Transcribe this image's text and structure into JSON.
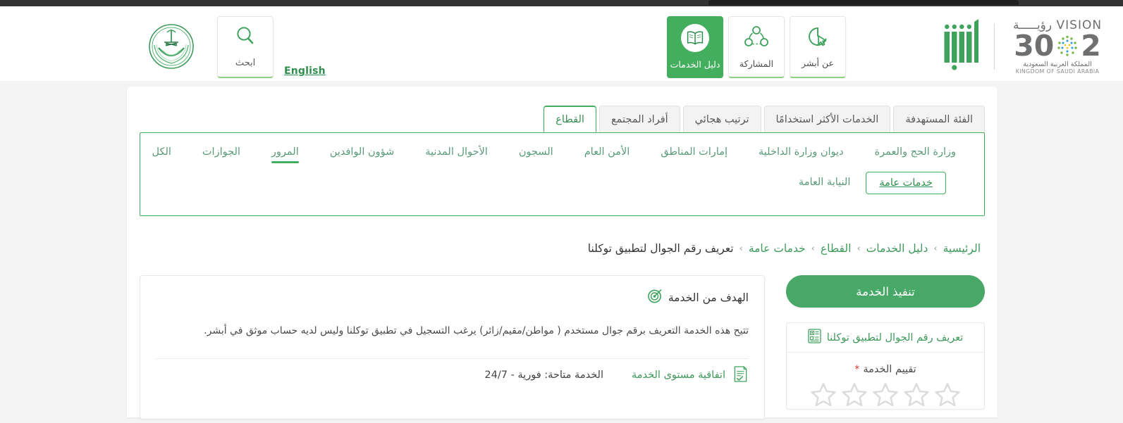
{
  "header": {
    "emblem_alt": "saudi-moi-emblem",
    "search": {
      "label": "ابحث",
      "icon": "search-icon"
    },
    "language_toggle": "English",
    "nav_tiles": [
      {
        "label": "دليل الخدمات",
        "icon": "book-icon",
        "active": true
      },
      {
        "label": "المشاركة",
        "icon": "share-nodes-icon",
        "active": false
      },
      {
        "label": "عن أبشر",
        "icon": "cursor-pie-icon",
        "active": false
      }
    ],
    "vision_logo": {
      "line1_en": "VISION",
      "line1_ar": "رؤيـــــة",
      "year_left": "2",
      "year_right": "30",
      "sub_ar": "المملكة العربية السعودية",
      "sub_en": "KINGDOM OF SAUDI ARABIA"
    },
    "absher_logo_alt": "absher-logo"
  },
  "tabs": [
    {
      "label": "القطاع",
      "active": true
    },
    {
      "label": "أفراد المجتمع",
      "active": false
    },
    {
      "label": "ترتيب هجائي",
      "active": false
    },
    {
      "label": "الخدمات الأكثر استخدامًا",
      "active": false
    },
    {
      "label": "الفئة المستهدفة",
      "active": false
    }
  ],
  "filters": {
    "row1": [
      {
        "label": "وزارة الحج والعمرة",
        "state": "normal"
      },
      {
        "label": "ديوان وزارة الداخلية",
        "state": "normal"
      },
      {
        "label": "إمارات المناطق",
        "state": "normal"
      },
      {
        "label": "الأمن العام",
        "state": "normal"
      },
      {
        "label": "السجون",
        "state": "normal"
      },
      {
        "label": "الأحوال المدنية",
        "state": "normal"
      },
      {
        "label": "شؤون الوافدين",
        "state": "normal"
      },
      {
        "label": "المرور",
        "state": "underline"
      },
      {
        "label": "الجوازات",
        "state": "normal"
      },
      {
        "label": "الكل",
        "state": "normal"
      }
    ],
    "row2": [
      {
        "label": "خدمات عامة",
        "state": "boxed"
      },
      {
        "label": "النيابة العامة",
        "state": "normal"
      }
    ]
  },
  "breadcrumb": {
    "separator": "›",
    "items": [
      {
        "label": "الرئيسية",
        "current": false
      },
      {
        "label": "دليل الخدمات",
        "current": false
      },
      {
        "label": "القطاع",
        "current": false
      },
      {
        "label": "خدمات عامة",
        "current": false
      },
      {
        "label": "تعريف رقم الجوال لتطبيق توكلنا",
        "current": true
      }
    ]
  },
  "main": {
    "goal": {
      "icon": "target-icon",
      "title": "الهدف من الخدمة",
      "body": "تتيح هذه الخدمة التعريف برقم جوال مستخدم ( مواطن/مقيم/زائر) يرغب التسجيل في تطبيق توكلنا وليس لديه حساب موثق في أبشر."
    },
    "sla": {
      "icon": "document-check-icon",
      "label": "اتفاقية مستوى الخدمة",
      "value": "الخدمة متاحة: فورية - 24/7"
    }
  },
  "sidebar": {
    "execute_button": "تنفيذ الخدمة",
    "service_card": {
      "icon": "form-qr-icon",
      "title": "تعريف رقم الجوال لتطبيق توكلنا",
      "rating_label": "تقييم الخدمة",
      "required_mark": "*",
      "stars_total": 5,
      "stars_filled": 0
    }
  },
  "colors": {
    "brand_green": "#43ae5e",
    "button_green": "#47a868",
    "link_green": "#3f9a5c",
    "muted_green": "#5a9b7b",
    "page_bg": "#f4f4f4",
    "required_red": "#d9342b",
    "logo_gray": "#6e6f71"
  }
}
